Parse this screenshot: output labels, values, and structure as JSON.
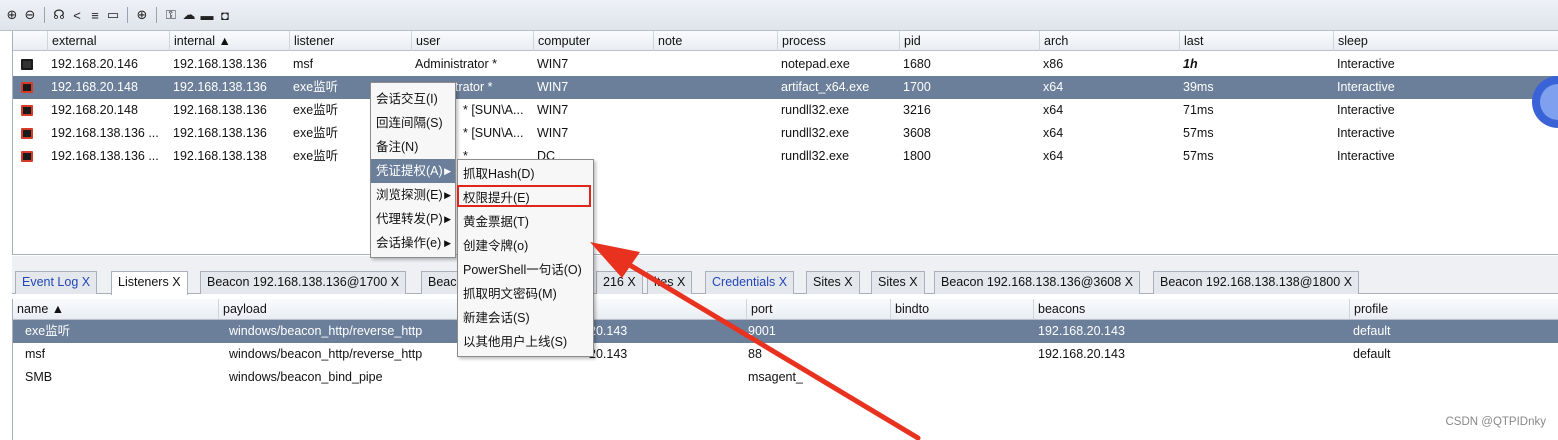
{
  "toolbar": {
    "icons": [
      "plus-circle-icon",
      "minus-circle-icon",
      "headphones-icon",
      "share-icon",
      "list-icon",
      "screen-icon",
      "globe-icon",
      "key-icon",
      "cloud-icon",
      "card-icon",
      "camera-icon"
    ]
  },
  "beacons_table": {
    "columns": [
      "external",
      "internal ▲",
      "listener",
      "user",
      "computer",
      "note",
      "process",
      "pid",
      "arch",
      "last",
      "sleep"
    ],
    "rows": [
      {
        "external": "192.168.20.146",
        "internal": "192.168.138.136",
        "listener": "msf",
        "user": "Administrator *",
        "computer": "WIN7",
        "note": "",
        "process": "notepad.exe",
        "pid": "1680",
        "arch": "x86",
        "last": "1h",
        "sleep": "Interactive"
      },
      {
        "external": "192.168.20.148",
        "internal": "192.168.138.136",
        "listener": "exe监听",
        "user": "trator *",
        "computer": "WIN7",
        "note": "",
        "process": "artifact_x64.exe",
        "pid": "1700",
        "arch": "x64",
        "last": "39ms",
        "sleep": "Interactive"
      },
      {
        "external": "192.168.20.148",
        "internal": "192.168.138.136",
        "listener": "exe监听",
        "user": "* [SUN\\A...",
        "computer": "WIN7",
        "note": "",
        "process": "rundll32.exe",
        "pid": "3216",
        "arch": "x64",
        "last": "71ms",
        "sleep": "Interactive"
      },
      {
        "external": "192.168.138.136 ...",
        "internal": "192.168.138.136",
        "listener": "exe监听",
        "user": "* [SUN\\A...",
        "computer": "WIN7",
        "note": "",
        "process": "rundll32.exe",
        "pid": "3608",
        "arch": "x64",
        "last": "57ms",
        "sleep": "Interactive"
      },
      {
        "external": "192.168.138.136 ...",
        "internal": "192.168.138.138",
        "listener": "exe监听",
        "user": "*",
        "computer": "DC",
        "note": "",
        "process": "rundll32.exe",
        "pid": "1800",
        "arch": "x64",
        "last": "57ms",
        "sleep": "Interactive"
      }
    ]
  },
  "tabs": [
    {
      "label": "Event Log",
      "close": "X",
      "color": "blue"
    },
    {
      "label": "Listeners",
      "close": "X",
      "color": "black",
      "active": true
    },
    {
      "label": "Beacon 192.168.138.136@1700",
      "close": "X",
      "color": "black"
    },
    {
      "label": "Beac",
      "close": "",
      "color": "black"
    },
    {
      "label": "216",
      "close": "X",
      "color": "black"
    },
    {
      "label": "ites",
      "close": "X",
      "color": "black"
    },
    {
      "label": "Credentials",
      "close": "X",
      "color": "blue"
    },
    {
      "label": "Sites",
      "close": "X",
      "color": "black"
    },
    {
      "label": "Sites",
      "close": "X",
      "color": "black"
    },
    {
      "label": "Beacon 192.168.138.136@3608",
      "close": "X",
      "color": "black"
    },
    {
      "label": "Beacon 192.168.138.138@1800",
      "close": "X",
      "color": "black"
    }
  ],
  "listeners_table": {
    "columns": [
      "name ▲",
      "payload",
      "host",
      "port",
      "bindto",
      "beacons",
      "profile"
    ],
    "rows": [
      {
        "name": "exe监听",
        "payload": "windows/beacon_http/reverse_http",
        "host": "20.143",
        "port": "9001",
        "bindto": "",
        "beacons": "192.168.20.143",
        "profile": "default"
      },
      {
        "name": "msf",
        "payload": "windows/beacon_http/reverse_http",
        "host": "20.143",
        "port": "88",
        "bindto": "",
        "beacons": "192.168.20.143",
        "profile": "default"
      },
      {
        "name": "SMB",
        "payload": "windows/beacon_bind_pipe",
        "host": "",
        "port": "msagent_",
        "bindto": "",
        "beacons": "",
        "profile": ""
      }
    ]
  },
  "context_menu": {
    "items": [
      "会话交互(I)",
      "回连间隔(S)",
      "备注(N)",
      "凭证提权(A)",
      "浏览探测(E)",
      "代理转发(P)",
      "会话操作(e)"
    ],
    "highlighted_index": 3
  },
  "submenu": {
    "items": [
      "抓取Hash(D)",
      "权限提升(E)",
      "黄金票据(T)",
      "创建令牌(o)",
      "PowerShell一句话(O)",
      "抓取明文密码(M)",
      "新建会话(S)",
      "以其他用户上线(S)"
    ],
    "boxed_index": 1
  },
  "colors": {
    "selection": "#6b7f9a",
    "highlight_box": "#e0261b",
    "arrow": "#e8321f",
    "tab_blue": "#2347b8"
  },
  "watermark": "CSDN @QTPIDnky"
}
